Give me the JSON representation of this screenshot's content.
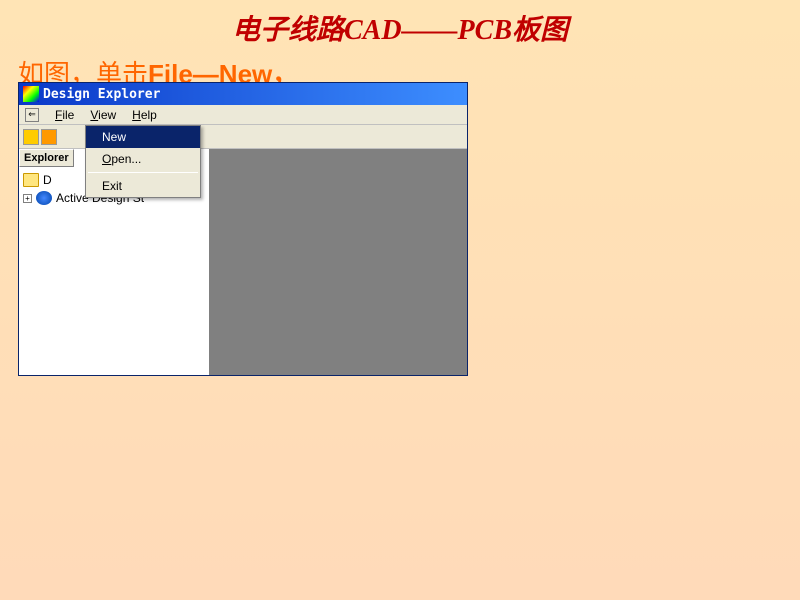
{
  "slide": {
    "title": "电子线路CAD——PCB板图",
    "instruction_prefix": "如图，单击",
    "instruction_bold": "File—New，"
  },
  "window": {
    "title": "Design Explorer",
    "menubar": {
      "file": "File",
      "view": "View",
      "help": "Help"
    },
    "explorer_tab": "Explorer",
    "tree": {
      "item1": "D",
      "item2": "Active Design St"
    },
    "dropdown": {
      "new": "New",
      "open": "Open...",
      "exit": "Exit"
    }
  }
}
